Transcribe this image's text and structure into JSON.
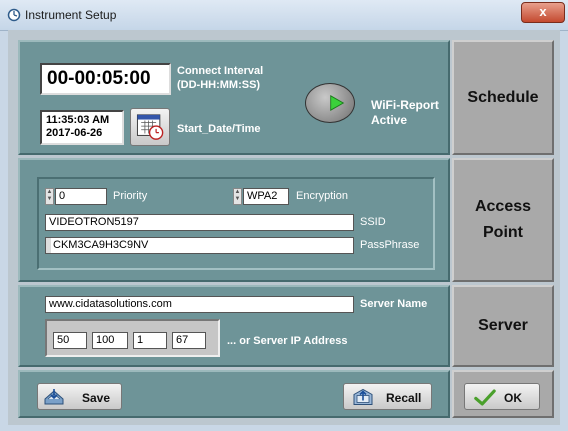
{
  "window": {
    "title": "Instrument Setup",
    "close_label": "x"
  },
  "schedule": {
    "interval_value": "00-00:05:00",
    "interval_label_1": "Connect Interval",
    "interval_label_2": "(DD-HH:MM:SS)",
    "start_time": "11:35:03 AM",
    "start_date": "2017-06-26",
    "start_label": "Start_Date/Time",
    "wifi_label_1": "WiFi-Report",
    "wifi_label_2": "Active",
    "wifi_active": true,
    "side_label": "Schedule"
  },
  "access_point": {
    "priority_value": "0",
    "priority_label": "Priority",
    "encryption_value": "WPA2",
    "encryption_label": "Encryption",
    "ssid_value": "VIDEOTRON5197",
    "ssid_label": "SSID",
    "passphrase_value": "CKM3CA9H3C9NV",
    "passphrase_label": "PassPhrase",
    "side_label_1": "Access",
    "side_label_2": "Point"
  },
  "server": {
    "name_value": "www.cidatasolutions.com",
    "name_label": "Server Name",
    "ip_octets": [
      "50",
      "100",
      "1",
      "67"
    ],
    "ip_label": "... or Server IP Address",
    "side_label": "Server"
  },
  "footer": {
    "save_label": "Save",
    "recall_label": "Recall",
    "ok_label": "OK"
  },
  "colors": {
    "panel": "#6e9498",
    "side_button": "#a9a9a9",
    "led_on": "#3bd13b"
  }
}
